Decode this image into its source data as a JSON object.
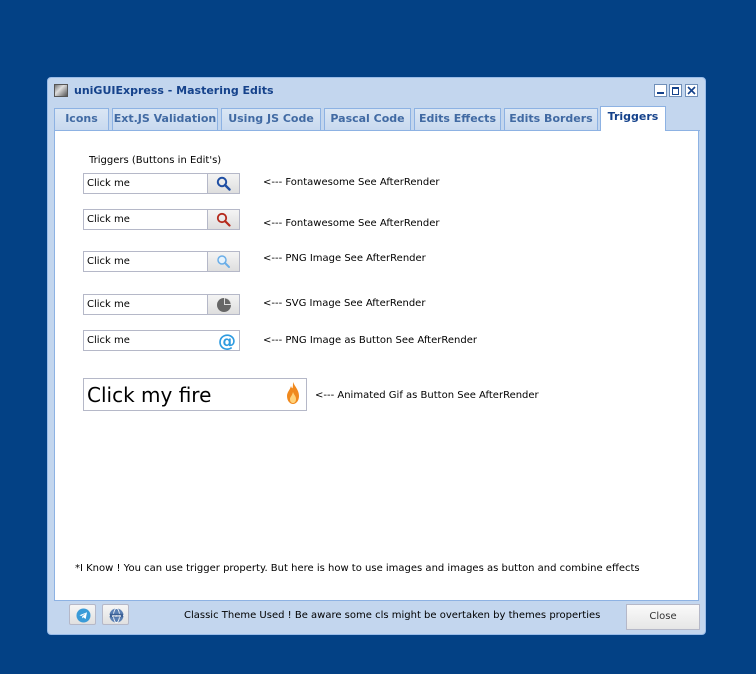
{
  "window": {
    "title": "uniGUIExpress - Mastering Edits"
  },
  "tabs": [
    {
      "label": "Icons"
    },
    {
      "label": "Ext.JS Validation"
    },
    {
      "label": "Using JS Code"
    },
    {
      "label": "Pascal Code"
    },
    {
      "label": "Edits Effects"
    },
    {
      "label": "Edits Borders"
    },
    {
      "label": "Triggers",
      "active": true
    }
  ],
  "content": {
    "group_label": "Triggers (Buttons in Edit's)",
    "rows": [
      {
        "value": "Click me",
        "icon": "search-icon",
        "note": "<--- Fontawesome See AfterRender"
      },
      {
        "value": "Click me",
        "icon": "search-icon",
        "note": "<--- Fontawesome See AfterRender"
      },
      {
        "value": "Click me",
        "icon": "search-icon",
        "note": "<--- PNG Image See AfterRender"
      },
      {
        "value": "Click me",
        "icon": "pie-chart-icon",
        "note": "<--- SVG Image See AfterRender"
      },
      {
        "value": "Click me",
        "icon": "at-sign-icon",
        "note": "<--- PNG Image as Button See AfterRender"
      }
    ],
    "big_field": {
      "value": "Click my fire",
      "icon": "fire-icon",
      "note": "<--- Animated Gif as Button See AfterRender"
    },
    "footnote": "*I Know ! You can use trigger property. But here is how to use images and images as button and combine effects"
  },
  "footer": {
    "message": "Classic Theme Used ! Be aware some cls might be overtaken by themes properties",
    "close_label": "Close",
    "buttons": [
      "telegram-icon",
      "www-icon"
    ]
  },
  "colors": {
    "desktop": "#034185",
    "window_frame": "#c3d6ee",
    "title_text": "#15428b",
    "tab_text": "#416aa3",
    "fa_blue": "#1f4ea3",
    "fa_red": "#b52a1c",
    "png_blue": "#6aaee8",
    "at_blue": "#2e9be0",
    "fire_orange": "#f0891e"
  }
}
